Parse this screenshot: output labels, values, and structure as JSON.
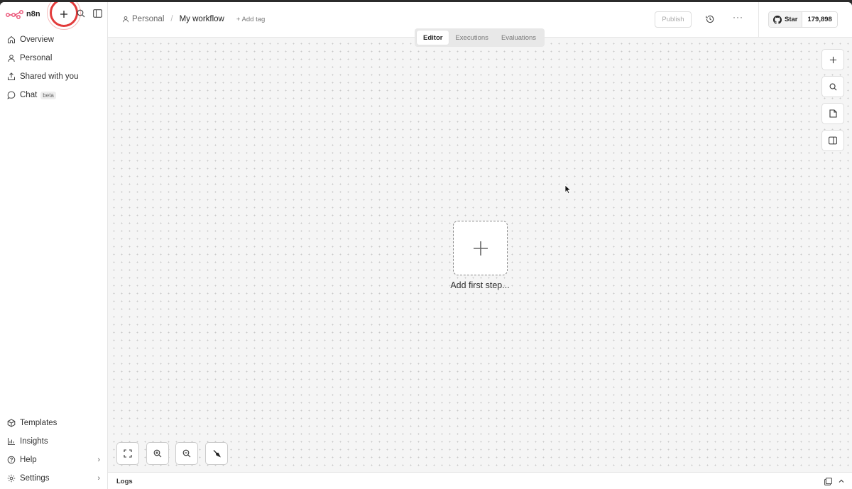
{
  "brand": {
    "name": "n8n"
  },
  "sidebar": {
    "top_items": [
      {
        "label": "Overview",
        "icon": "home-icon"
      },
      {
        "label": "Personal",
        "icon": "user-icon"
      },
      {
        "label": "Shared with you",
        "icon": "share-icon"
      },
      {
        "label": "Chat",
        "icon": "chat-icon",
        "badge": "beta"
      }
    ],
    "bottom_items": [
      {
        "label": "Templates",
        "icon": "templates-icon"
      },
      {
        "label": "Insights",
        "icon": "insights-icon"
      },
      {
        "label": "Help",
        "icon": "help-icon",
        "chevron": "›"
      },
      {
        "label": "Settings",
        "icon": "gear-icon",
        "chevron": "›"
      }
    ]
  },
  "header": {
    "project": "Personal",
    "separator": "/",
    "workflow_name": "My workflow",
    "add_tag": "+ Add tag",
    "publish_label": "Publish",
    "more_label": "···",
    "github": {
      "star_label": "Star",
      "count": "179,898"
    }
  },
  "tabs": [
    {
      "label": "Editor",
      "active": true
    },
    {
      "label": "Executions",
      "active": false
    },
    {
      "label": "Evaluations",
      "active": false
    }
  ],
  "canvas": {
    "add_first_step_label": "Add first step..."
  },
  "logs": {
    "label": "Logs"
  },
  "colors": {
    "accent": "#e23b3b",
    "canvas_bg": "#f5f5f5",
    "logo": "#ea4b71"
  }
}
